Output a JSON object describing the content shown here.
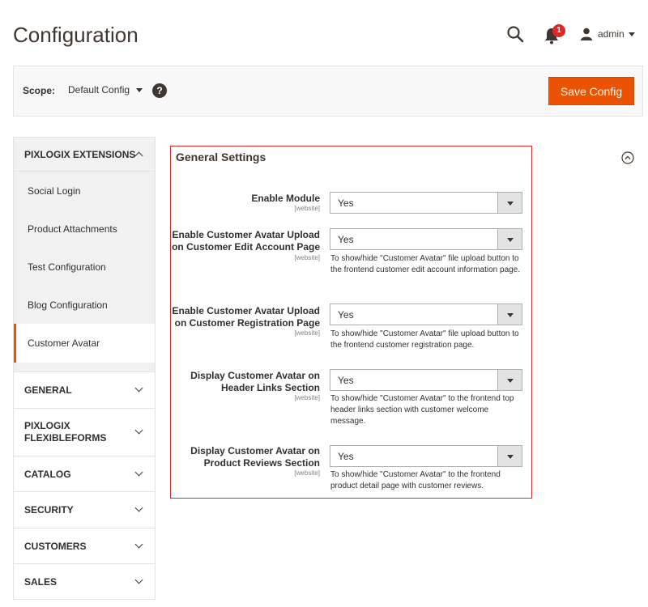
{
  "header": {
    "title": "Configuration",
    "notifications_count": "1",
    "user_name": "admin"
  },
  "scope": {
    "label": "Scope:",
    "value": "Default Config",
    "help": "?",
    "save_label": "Save Config"
  },
  "sidebar": {
    "group_label": "PIXLOGIX EXTENSIONS",
    "items": [
      {
        "label": "Social Login"
      },
      {
        "label": "Product Attachments"
      },
      {
        "label": "Test Configuration"
      },
      {
        "label": "Blog Configuration"
      },
      {
        "label": "Customer Avatar"
      }
    ],
    "sections": [
      {
        "label": "GENERAL"
      },
      {
        "label": "PIXLOGIX FLEXIBLEFORMS"
      },
      {
        "label": "CATALOG"
      },
      {
        "label": "SECURITY"
      },
      {
        "label": "CUSTOMERS"
      },
      {
        "label": "SALES"
      }
    ]
  },
  "main": {
    "section_title": "General Settings",
    "fields": [
      {
        "label": "Enable Module",
        "scope": "[website]",
        "value": "Yes",
        "note": ""
      },
      {
        "label": "Enable Customer Avatar Upload on Customer Edit Account Page",
        "scope": "[website]",
        "value": "Yes",
        "note": "To show/hide \"Customer Avatar\" file upload button to the frontend customer edit account information page."
      },
      {
        "label": "Enable Customer Avatar Upload on Customer Registration Page",
        "scope": "[website]",
        "value": "Yes",
        "note": "To show/hide \"Customer Avatar\" file upload button to the frontend customer registration page."
      },
      {
        "label": "Display Customer Avatar on Header Links Section",
        "scope": "[website]",
        "value": "Yes",
        "note": "To show/hide \"Customer Avatar\" to the frontend top header links section with customer welcome message."
      },
      {
        "label": "Display Customer Avatar on Product Reviews Section",
        "scope": "[website]",
        "value": "Yes",
        "note": "To show/hide \"Customer Avatar\" to the frontend product detail page with customer reviews."
      }
    ]
  },
  "colors": {
    "accent": "#eb5202",
    "highlight_border": "#e02b27",
    "badge": "#e22626"
  }
}
